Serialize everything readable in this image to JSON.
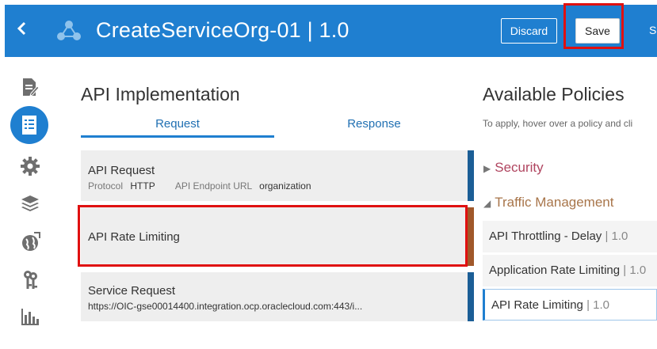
{
  "header": {
    "back_icon": "chevron-left-icon",
    "app_icon": "integration-icon",
    "title": "CreateServiceOrg-01 | 1.0",
    "discard_label": "Discard",
    "save_label": "Save",
    "truncated_label": "S"
  },
  "rail": {
    "items": [
      {
        "icon": "document-edit-icon"
      },
      {
        "icon": "list-document-icon",
        "active": true
      },
      {
        "icon": "gear-icon"
      },
      {
        "icon": "layers-icon"
      },
      {
        "icon": "globe-icon"
      },
      {
        "icon": "keys-icon"
      },
      {
        "icon": "bar-chart-icon"
      }
    ]
  },
  "implementation": {
    "title": "API Implementation",
    "tabs": [
      {
        "label": "Request",
        "active": true
      },
      {
        "label": "Response",
        "active": false
      }
    ],
    "cards": [
      {
        "title": "API Request",
        "protocol_key": "Protocol",
        "protocol_value": "HTTP",
        "endpoint_key": "API Endpoint URL",
        "endpoint_value": "organization"
      },
      {
        "title": "API Rate Limiting"
      },
      {
        "title": "Service Request",
        "url": "https://OIC-gse00014400.integration.ocp.oraclecloud.com:443/i..."
      }
    ]
  },
  "policies": {
    "title": "Available Policies",
    "hint": "To apply, hover over a policy and cli",
    "sections": [
      {
        "label": "Security",
        "expanded": false,
        "color": "#b04560"
      },
      {
        "label": "Traffic Management",
        "expanded": true,
        "color": "#a8754a"
      }
    ],
    "items": [
      {
        "name": "API Throttling - Delay",
        "version": "1.0"
      },
      {
        "name": "Application Rate Limiting",
        "version": "1.0"
      },
      {
        "name": "API Rate Limiting",
        "version": "1.0",
        "selected": true
      }
    ]
  },
  "colors": {
    "brand": "#1f7fd0",
    "highlight": "#e01010",
    "flow_bar_blue": "#1b5e96",
    "flow_bar_brown": "#a0582a"
  }
}
